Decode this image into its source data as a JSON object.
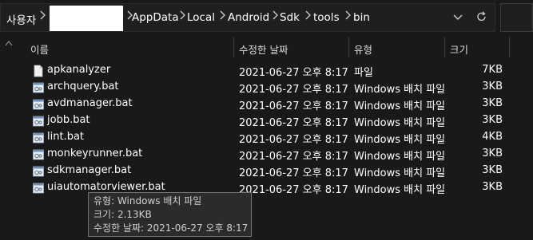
{
  "address_bar": {
    "root_label": "사용자",
    "path": [
      "AppData",
      "Local",
      "Android",
      "Sdk",
      "tools",
      "bin"
    ]
  },
  "columns": {
    "name": "이름",
    "date": "수정한 날짜",
    "type": "유형",
    "size": "크기"
  },
  "files": [
    {
      "name": "apkanalyzer",
      "date": "2021-06-27 오후 8:17",
      "type": "파일",
      "size": "7KB",
      "icon": "file-icon"
    },
    {
      "name": "archquery.bat",
      "date": "2021-06-27 오후 8:17",
      "type": "Windows 배치 파일",
      "size": "3KB",
      "icon": "batch-file-icon"
    },
    {
      "name": "avdmanager.bat",
      "date": "2021-06-27 오후 8:17",
      "type": "Windows 배치 파일",
      "size": "3KB",
      "icon": "batch-file-icon"
    },
    {
      "name": "jobb.bat",
      "date": "2021-06-27 오후 8:17",
      "type": "Windows 배치 파일",
      "size": "3KB",
      "icon": "batch-file-icon"
    },
    {
      "name": "lint.bat",
      "date": "2021-06-27 오후 8:17",
      "type": "Windows 배치 파일",
      "size": "4KB",
      "icon": "batch-file-icon"
    },
    {
      "name": "monkeyrunner.bat",
      "date": "2021-06-27 오후 8:17",
      "type": "Windows 배치 파일",
      "size": "3KB",
      "icon": "batch-file-icon"
    },
    {
      "name": "sdkmanager.bat",
      "date": "2021-06-27 오후 8:17",
      "type": "Windows 배치 파일",
      "size": "3KB",
      "icon": "batch-file-icon"
    },
    {
      "name": "uiautomatorviewer.bat",
      "date": "2021-06-27 오후 8:17",
      "type": "Windows 배치 파일",
      "size": "3KB",
      "icon": "batch-file-icon"
    }
  ],
  "tooltip": {
    "type_line": "유형: Windows 배치 파일",
    "size_line": "크기: 2.13KB",
    "date_line": "수정한 날짜: 2021-06-27 오후 8:17"
  }
}
